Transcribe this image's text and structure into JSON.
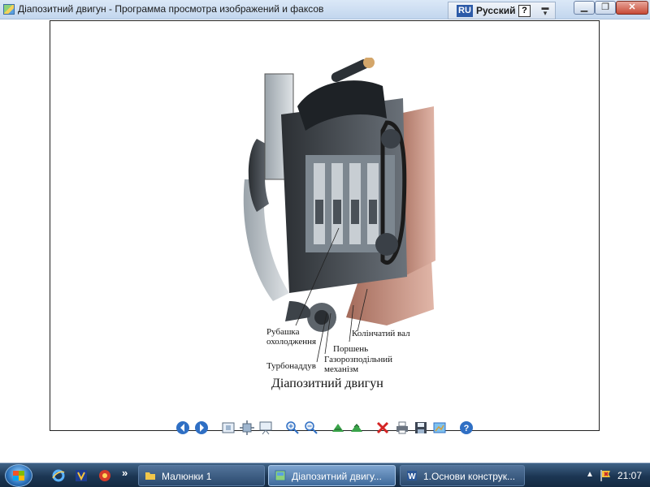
{
  "window": {
    "title": "Діапозитний двигун - Программа просмотра изображений и факсов"
  },
  "language_bar": {
    "code": "RU",
    "name": "Русский",
    "help": "?"
  },
  "image": {
    "caption": "Діапозитний двигун",
    "labels": {
      "jacket": "Рубашка охолодження",
      "crankshaft": "Колінчатий вал",
      "piston": "Поршень",
      "timing": "Газорозподільний механізм",
      "turbo": "Турбонаддув"
    }
  },
  "toolbar": {
    "icons": [
      "prev-image-icon",
      "next-image-icon",
      "best-fit-icon",
      "actual-size-icon",
      "slideshow-icon",
      "zoom-in-icon",
      "zoom-out-icon",
      "rotate-clockwise-icon",
      "rotate-counterclockwise-icon",
      "delete-icon",
      "print-icon",
      "save-icon",
      "edit-icon",
      "help-icon"
    ]
  },
  "taskbar": {
    "quick_launch_more": "»",
    "tasks": [
      {
        "label": "Малюнки 1",
        "active": false
      },
      {
        "label": "Діапозитний двигу...",
        "active": true
      },
      {
        "label": "1.Основи конструк...",
        "active": false
      }
    ],
    "clock": "21:07"
  },
  "colors": {
    "titlebar": "#c2d6ee",
    "taskbar": "#1c3653",
    "close_button": "#c74a36"
  }
}
